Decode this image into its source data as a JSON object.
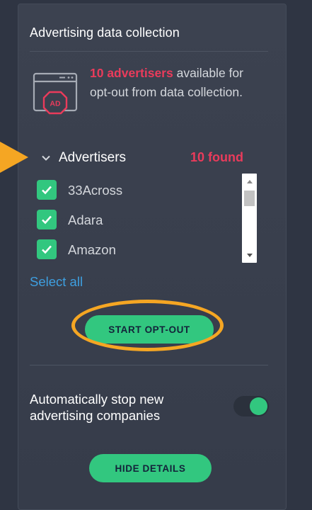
{
  "section": {
    "heading": "Advertising data collection"
  },
  "summary": {
    "count_text": "10 advertisers",
    "rest_text": " available for opt-out from data collection."
  },
  "ad_icon_label": "AD",
  "advertisers": {
    "title": "Advertisers",
    "found_text": "10 found",
    "items": [
      {
        "name": "33Across",
        "checked": true
      },
      {
        "name": "Adara",
        "checked": true
      },
      {
        "name": "Amazon",
        "checked": true
      }
    ],
    "select_all_label": "Select all"
  },
  "actions": {
    "start_label": "START OPT-OUT",
    "hide_label": "HIDE DETAILS"
  },
  "auto_stop": {
    "label": "Automatically stop new advertising companies",
    "enabled": true
  },
  "colors": {
    "accent_green": "#32c77f",
    "highlight_red": "#ea3b5b",
    "link_blue": "#3e9fe0",
    "annotation_orange": "#f5a623",
    "panel_bg": "#3a404e"
  },
  "icons": {
    "browser_ad": "browser-ad-icon",
    "chevron": "chevron-down-icon",
    "check": "check-icon"
  }
}
